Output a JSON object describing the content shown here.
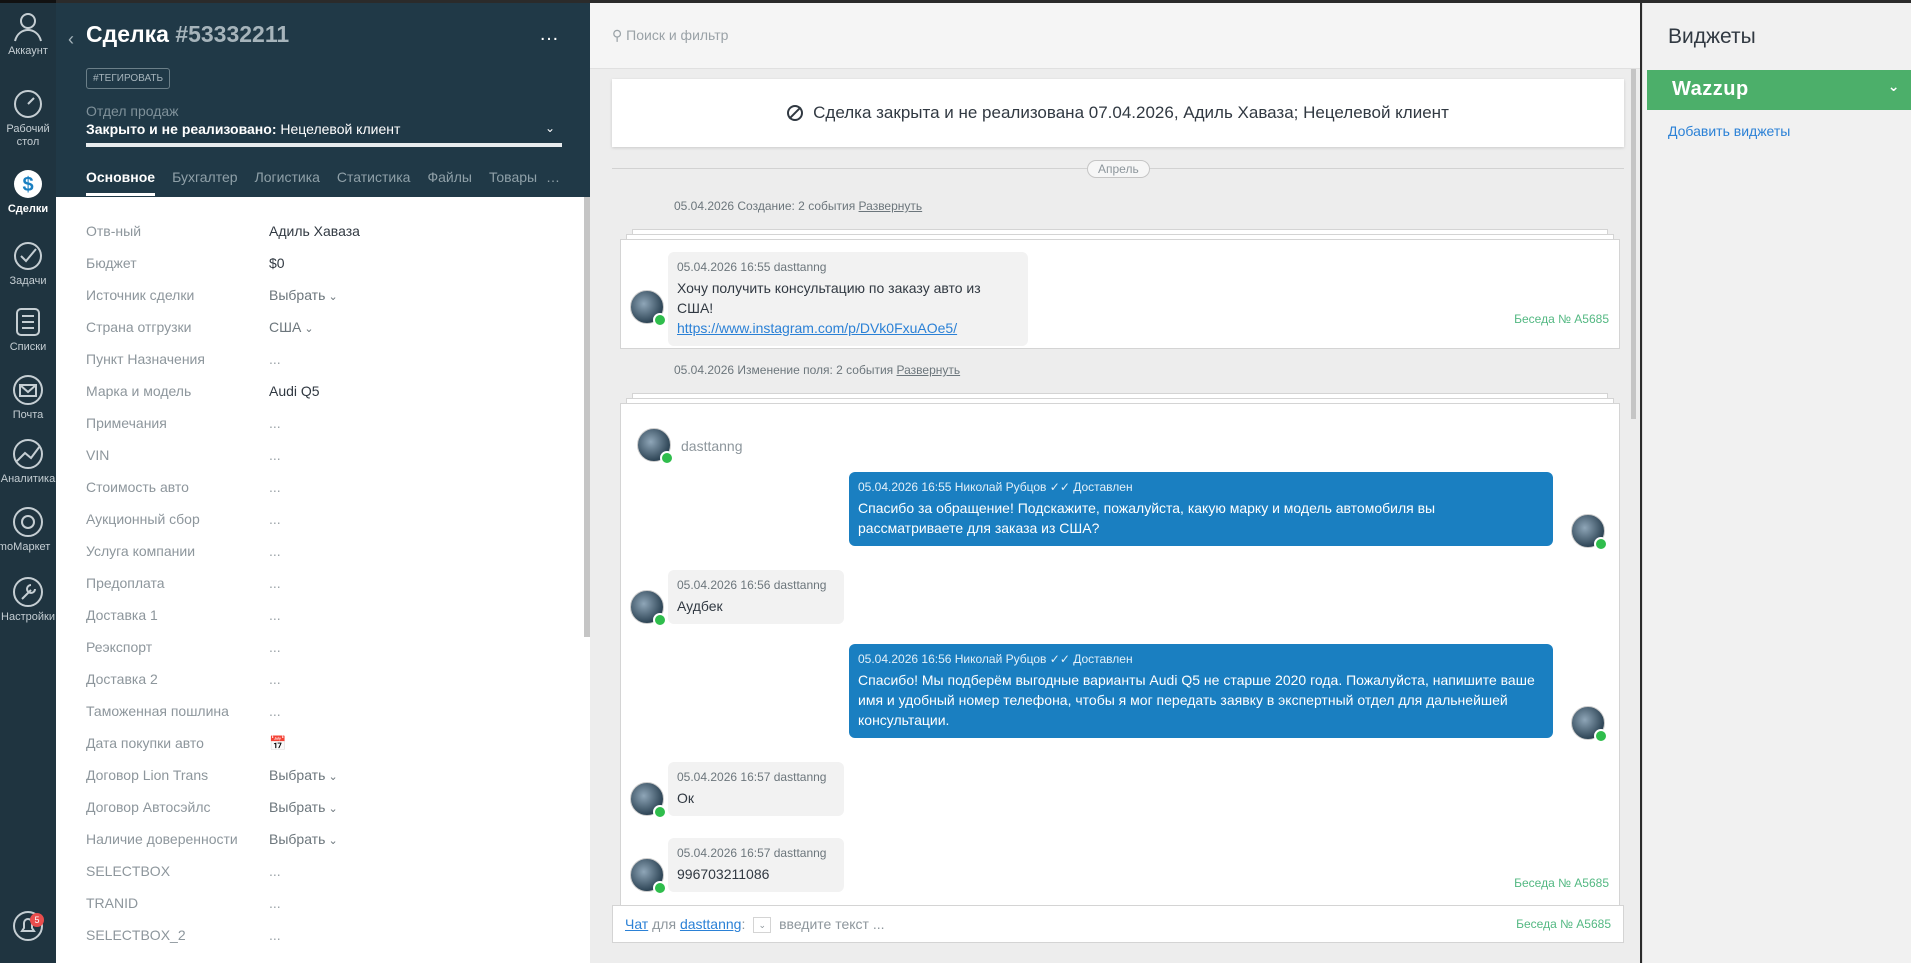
{
  "nav": [
    {
      "label": "Аккаунт",
      "icon": "account-icon"
    },
    {
      "label": "Рабочий стол",
      "icon": "dashboard-icon"
    },
    {
      "label": "Сделки",
      "icon": "deals-icon",
      "active": true
    },
    {
      "label": "Задачи",
      "icon": "tasks-icon"
    },
    {
      "label": "Списки",
      "icon": "lists-icon"
    },
    {
      "label": "Почта",
      "icon": "mail-icon"
    },
    {
      "label": "Аналитика",
      "icon": "analytics-icon"
    },
    {
      "label": "amoМаркет",
      "icon": "market-icon"
    },
    {
      "label": "Настройки",
      "icon": "settings-icon"
    }
  ],
  "notifications": {
    "count": "5"
  },
  "card": {
    "title": "Сделка",
    "number": "#53332211",
    "more": "…",
    "tag_button": "#ТЕГИРОВАТЬ",
    "pipeline_label": "Отдел продаж",
    "status_bold": "Закрыто и не реализовано:",
    "status_reason": "Нецелевой клиент",
    "tabs": [
      "Основное",
      "Бухгалтер",
      "Логистика",
      "Статистика",
      "Файлы",
      "Товары"
    ],
    "tabs_more": "…",
    "fields": [
      {
        "label": "Отв-ный",
        "value": "Адиль Хаваза",
        "type": "text"
      },
      {
        "label": "Бюджет",
        "value": "$0",
        "type": "text"
      },
      {
        "label": "Источник сделки",
        "value": "Выбрать",
        "type": "select"
      },
      {
        "label": "Страна отгрузки",
        "value": "США",
        "type": "select"
      },
      {
        "label": "Пункт Назначения",
        "value": "...",
        "type": "empty"
      },
      {
        "label": "Марка и модель",
        "value": "Audi Q5",
        "type": "text"
      },
      {
        "label": "Примечания",
        "value": "...",
        "type": "empty"
      },
      {
        "label": "VIN",
        "value": "...",
        "type": "empty"
      },
      {
        "label": "Стоимость авто",
        "value": "...",
        "type": "empty"
      },
      {
        "label": "Аукционный сбор",
        "value": "...",
        "type": "empty"
      },
      {
        "label": "Услуга компании",
        "value": "...",
        "type": "empty"
      },
      {
        "label": "Предоплата",
        "value": "...",
        "type": "empty"
      },
      {
        "label": "Доставка 1",
        "value": "...",
        "type": "empty"
      },
      {
        "label": "Реэкспорт",
        "value": "...",
        "type": "empty"
      },
      {
        "label": "Доставка 2",
        "value": "...",
        "type": "empty"
      },
      {
        "label": "Таможенная пошлина",
        "value": "...",
        "type": "empty"
      },
      {
        "label": "Дата покупки авто",
        "value": "📅",
        "type": "empty"
      },
      {
        "label": "Договор Lion Trans",
        "value": "Выбрать",
        "type": "select"
      },
      {
        "label": "Договор Автосэйлс",
        "value": "Выбрать",
        "type": "select"
      },
      {
        "label": "Наличие доверенности",
        "value": "Выбрать",
        "type": "select"
      },
      {
        "label": "SELECTBOX",
        "value": "...",
        "type": "empty"
      },
      {
        "label": "TRANID",
        "value": "...",
        "type": "empty"
      },
      {
        "label": "SELECTBOX_2",
        "value": "...",
        "type": "empty"
      }
    ]
  },
  "feed": {
    "search_placeholder": "Поиск и фильтр",
    "closed_banner": "Сделка закрыта и не реализована 07.04.2026, Адиль Хаваза; Нецелевой клиент",
    "month": "Апрель",
    "event1": {
      "text": "05.04.2026 Создание: 2 события",
      "link": "Развернуть"
    },
    "event2": {
      "text": "05.04.2026 Изменение поля: 2 события",
      "link": "Развернуть"
    },
    "conv_number": "Беседа № A5685",
    "msg1": {
      "meta": "05.04.2026 16:55 dasttanng",
      "text": "Хочу получить консультацию по заказу авто из США!",
      "link": "https://www.instagram.com/p/DVk0FxuAOe5/"
    },
    "sender": "dasttanng",
    "out1": {
      "meta": "05.04.2026 16:55 Николай Рубцов ✓✓ Доставлен",
      "text": "Спасибо за обращение! Подскажите, пожалуйста, какую марку и модель автомобиля вы рассматриваете для заказа из США?"
    },
    "in2": {
      "meta": "05.04.2026 16:56 dasttanng",
      "text": "Аудбек"
    },
    "out2": {
      "meta": "05.04.2026 16:56 Николай Рубцов ✓✓ Доставлен",
      "text": "Спасибо! Мы подберём выгодные варианты Audi Q5 не старше 2020 года. Пожалуйста, напишите ваше имя и удобный номер телефона, чтобы я мог передать заявку в экспертный отдел для дальнейшей консультации."
    },
    "in3": {
      "meta": "05.04.2026 16:57 dasttanng",
      "text": "Ок"
    },
    "in4": {
      "meta": "05.04.2026 16:57 dasttanng",
      "text": "996703211086"
    },
    "composer": {
      "chat": "Чат",
      "for": "для",
      "recipient": "dasttanng",
      "placeholder": "введите текст ...",
      "conv": "Беседа № A5685"
    }
  },
  "widgets": {
    "title": "Виджеты",
    "wazzup": "Wazzup",
    "add": "Добавить виджеты"
  }
}
